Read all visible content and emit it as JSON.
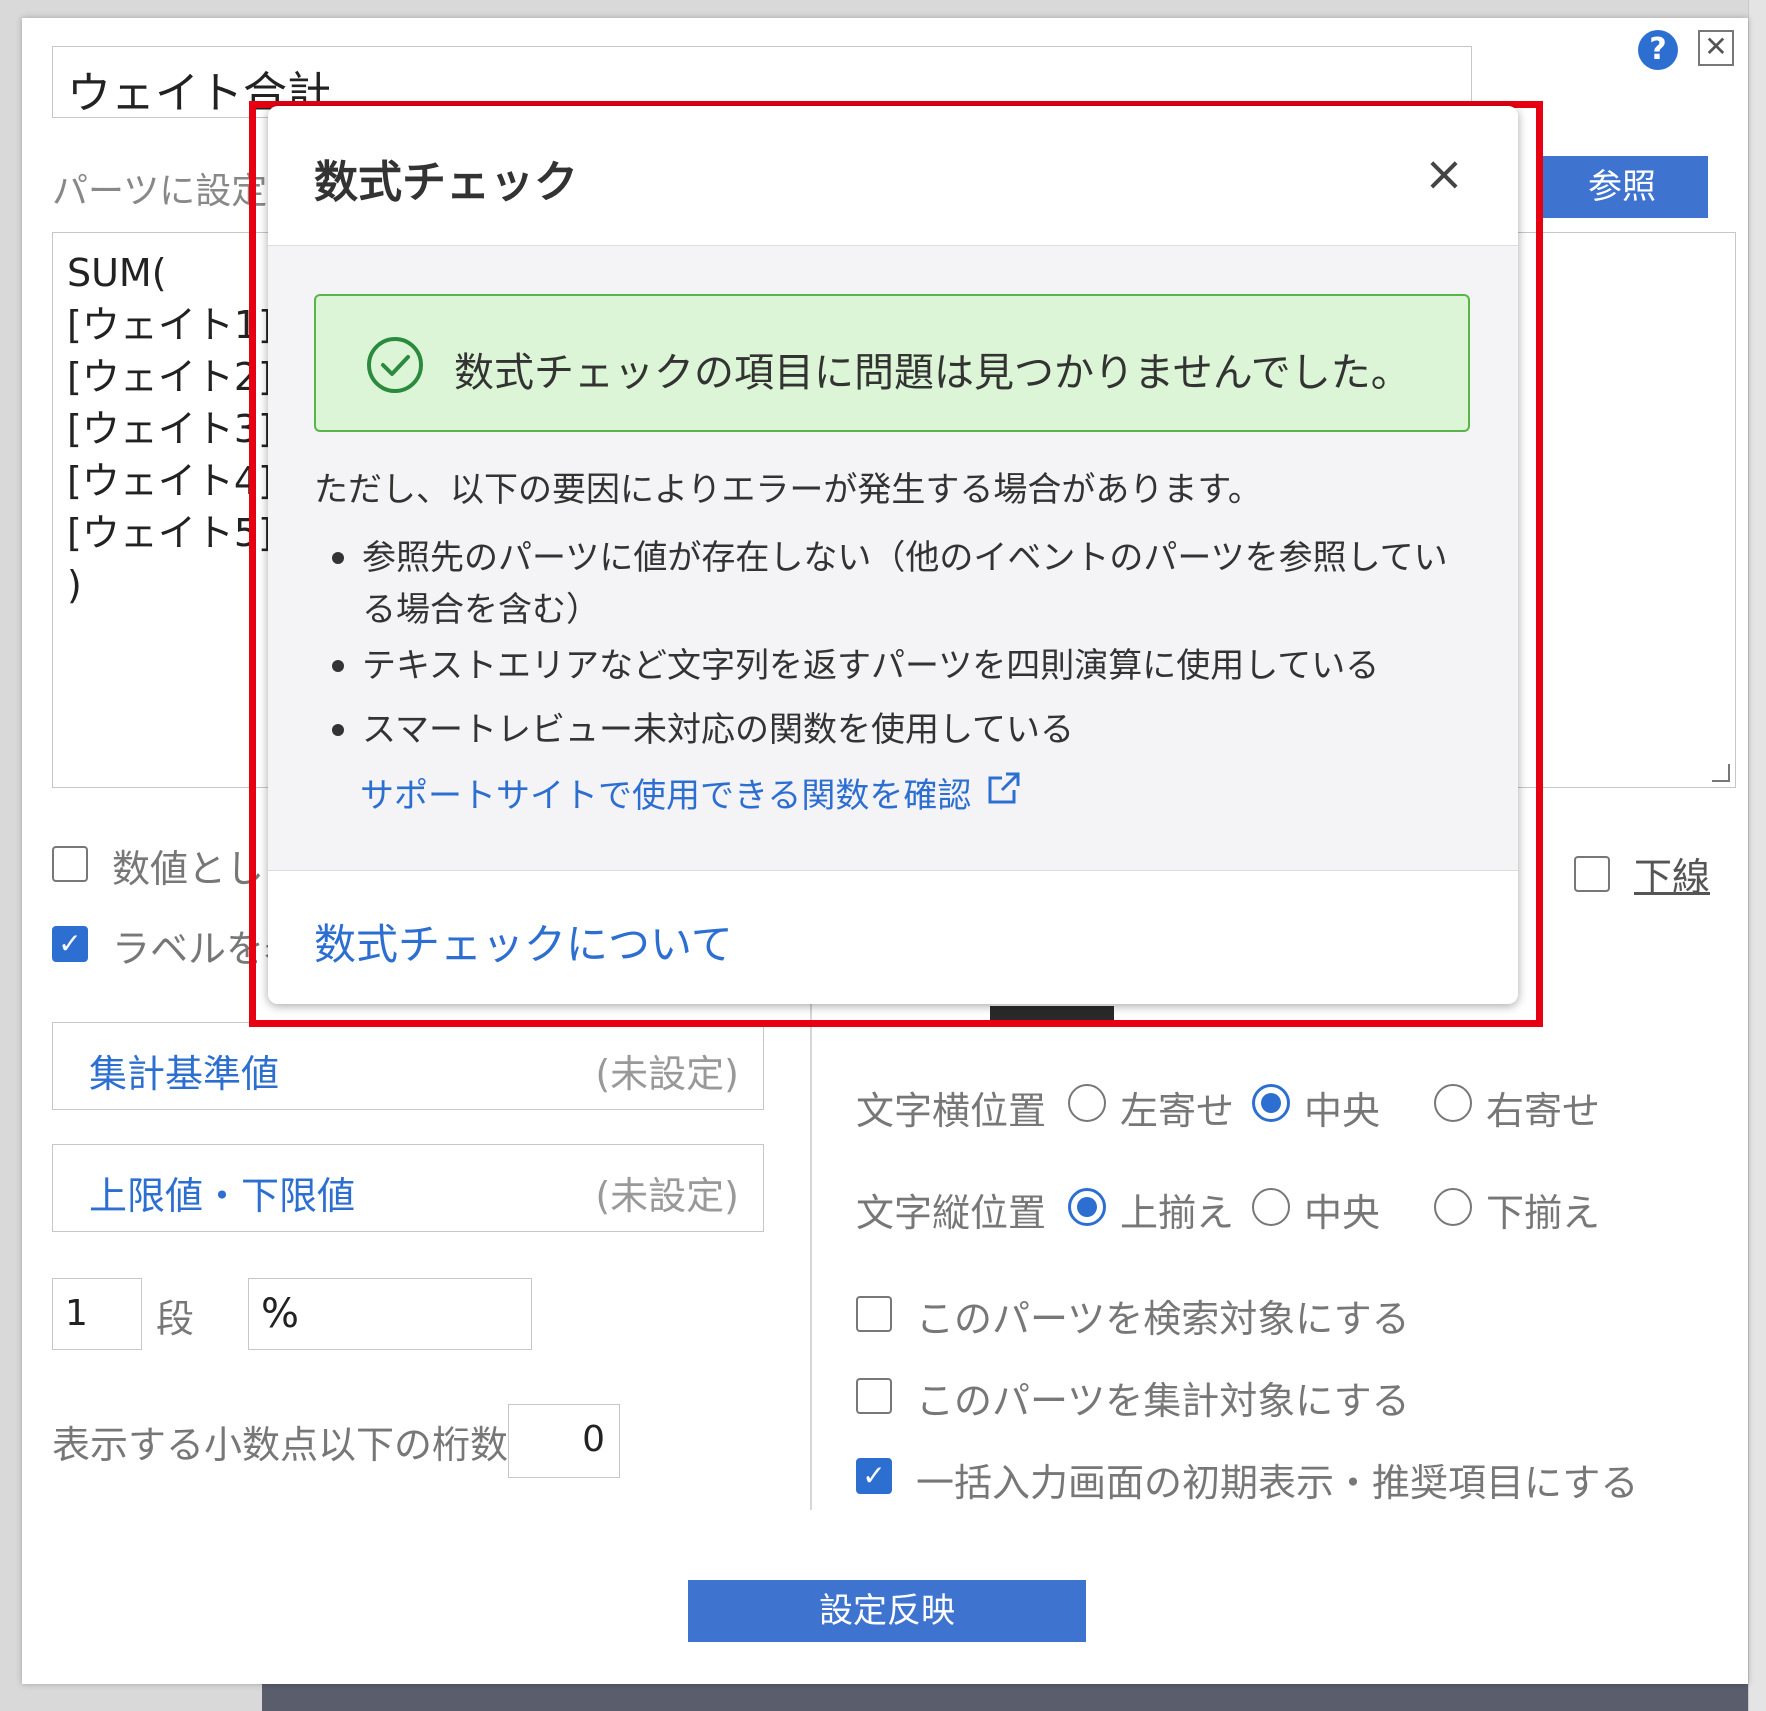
{
  "dialog": {
    "title_value": "ウェイト合計",
    "help_icon": "?",
    "close_icon": "✕",
    "parts_label": "パーツに設定",
    "ref_button": "参照",
    "formula": "SUM(\n[ウェイト1]\n[ウェイト2]\n[ウェイト3]\n[ウェイト4]\n[ウェイト5]\n)",
    "as_number_label": "数値とし",
    "show_label_label": "ラベルを表",
    "underline_label": "下線",
    "aggregate_field": {
      "name": "集計基準値",
      "state": "(未設定)"
    },
    "limit_field": {
      "name": "上限値・下限値",
      "state": "(未設定)"
    },
    "rows_value": "1",
    "rows_unit": "段",
    "suffix_value": "%",
    "decimals_label": "表示する小数点以下の桁数",
    "decimals_value": "0",
    "h_align": {
      "label": "文字横位置",
      "options": [
        "左寄せ",
        "中央",
        "右寄せ"
      ],
      "selected": "中央"
    },
    "v_align": {
      "label": "文字縦位置",
      "options": [
        "上揃え",
        "中央",
        "下揃え"
      ],
      "selected": "上揃え"
    },
    "search_target_label": "このパーツを検索対象にする",
    "aggregate_target_label": "このパーツを集計対象にする",
    "bulk_input_label": "一括入力画面の初期表示・推奨項目にする",
    "apply_button": "設定反映"
  },
  "modal": {
    "title": "数式チェック",
    "close_icon": "×",
    "success_message": "数式チェックの項目に問題は見つかりませんでした。",
    "note": "ただし、以下の要因によりエラーが発生する場合があります。",
    "bullets": [
      "参照先のパーツに値が存在しない（他のイベントのパーツを参照している場合を含む）",
      "テキストエリアなど文字列を返すパーツを四則演算に使用している",
      "スマートレビュー未対応の関数を使用している"
    ],
    "support_link": "サポートサイトで使用できる関数を確認",
    "about_link": "数式チェックについて"
  },
  "colors": {
    "accent": "#2d6fd1",
    "highlight": "#e60012",
    "success_bg": "#dcf5d6",
    "success_border": "#59b54a"
  }
}
